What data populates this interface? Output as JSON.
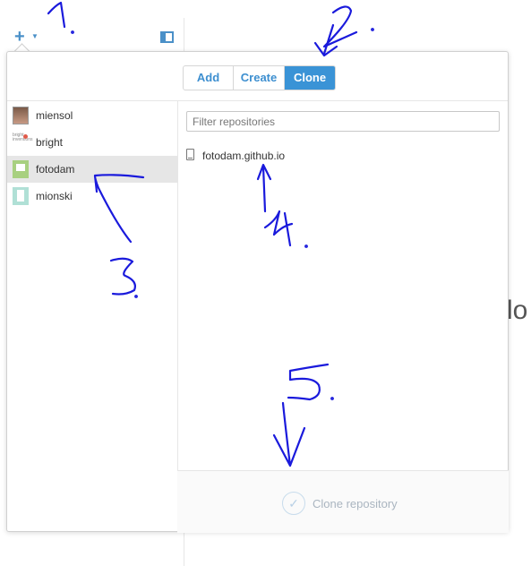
{
  "toolbar": {
    "add_icon": "plus-icon",
    "dropdown_icon": "caret-down-icon",
    "panel_icon": "sidebar-toggle-icon"
  },
  "background": {
    "partial_text": "lo"
  },
  "popover": {
    "tabs": [
      {
        "label": "Add",
        "active": false
      },
      {
        "label": "Create",
        "active": false
      },
      {
        "label": "Clone",
        "active": true
      }
    ],
    "accounts": [
      {
        "name": "miensol",
        "selected": false
      },
      {
        "name": "bright",
        "avatar_text": "bright inventions",
        "selected": false
      },
      {
        "name": "fotodam",
        "selected": true
      },
      {
        "name": "mionski",
        "selected": false
      }
    ],
    "filter_placeholder": "Filter repositories",
    "repositories": [
      {
        "name": "fotodam.github.io"
      }
    ],
    "clone_button": {
      "label": "Clone repository",
      "icon": "checkmark-icon",
      "enabled": false
    }
  },
  "colors": {
    "accent": "#3a93d6",
    "annotation_ink": "#1a1adc",
    "selected_row": "#e6e6e6"
  },
  "annotations": [
    {
      "label": "1."
    },
    {
      "label": "2."
    },
    {
      "label": "3."
    },
    {
      "label": "4."
    },
    {
      "label": "5."
    }
  ]
}
